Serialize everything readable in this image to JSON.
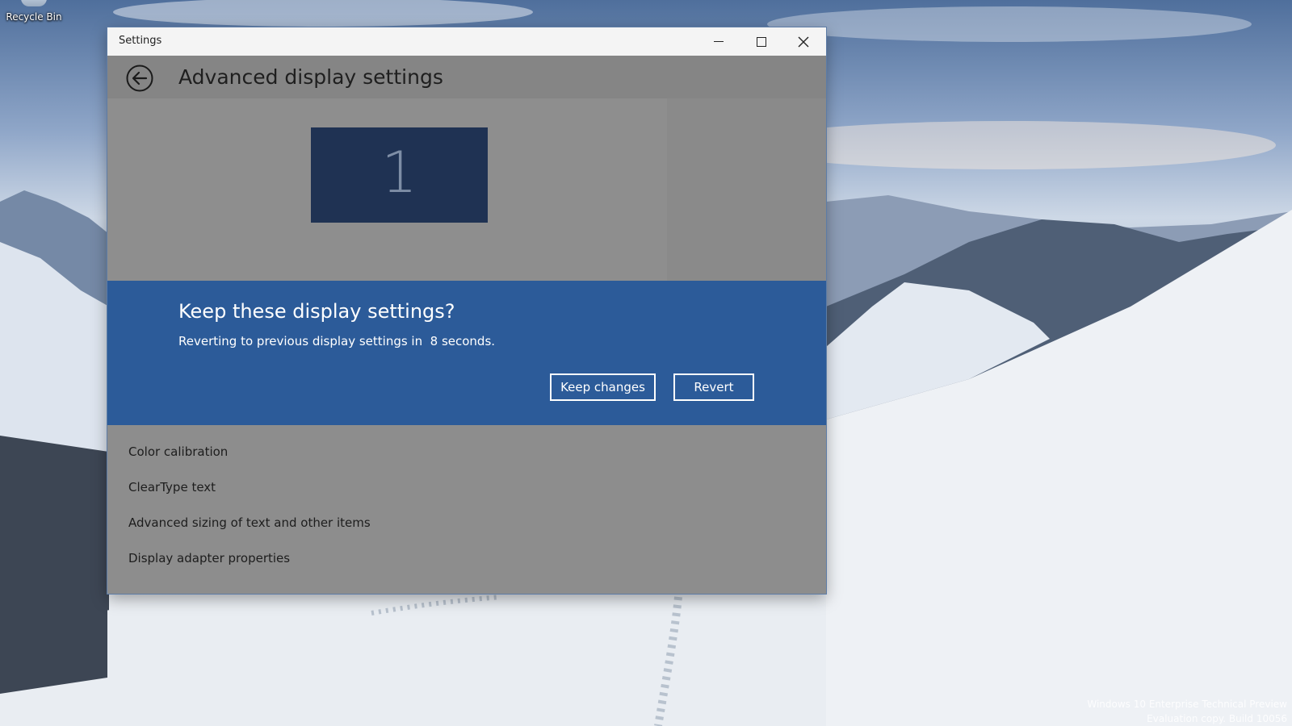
{
  "desktop": {
    "recycle_bin_label": "Recycle Bin",
    "watermark_line1": "Windows 10 Enterprise Technical Preview",
    "watermark_line2": "Evaluation copy. Build 10056"
  },
  "window": {
    "title": "Settings",
    "minimize_icon": "minimize-icon",
    "maximize_icon": "maximize-icon",
    "close_icon": "close-icon"
  },
  "page": {
    "back_icon": "back-arrow-icon",
    "title": "Advanced display settings"
  },
  "display_preview": {
    "monitor_number": "1"
  },
  "dialog": {
    "title": "Keep these display settings?",
    "message": "Reverting to previous display settings in  8 seconds.",
    "keep_label": "Keep changes",
    "revert_label": "Revert"
  },
  "links": [
    {
      "label": "Color calibration"
    },
    {
      "label": "ClearType text"
    },
    {
      "label": "Advanced sizing of text and other items"
    },
    {
      "label": "Display adapter properties"
    }
  ],
  "colors": {
    "dialog_bg": "#2c5b99",
    "monitor_bg": "#1f3253",
    "overlay_gray": "#8d8d8d"
  }
}
